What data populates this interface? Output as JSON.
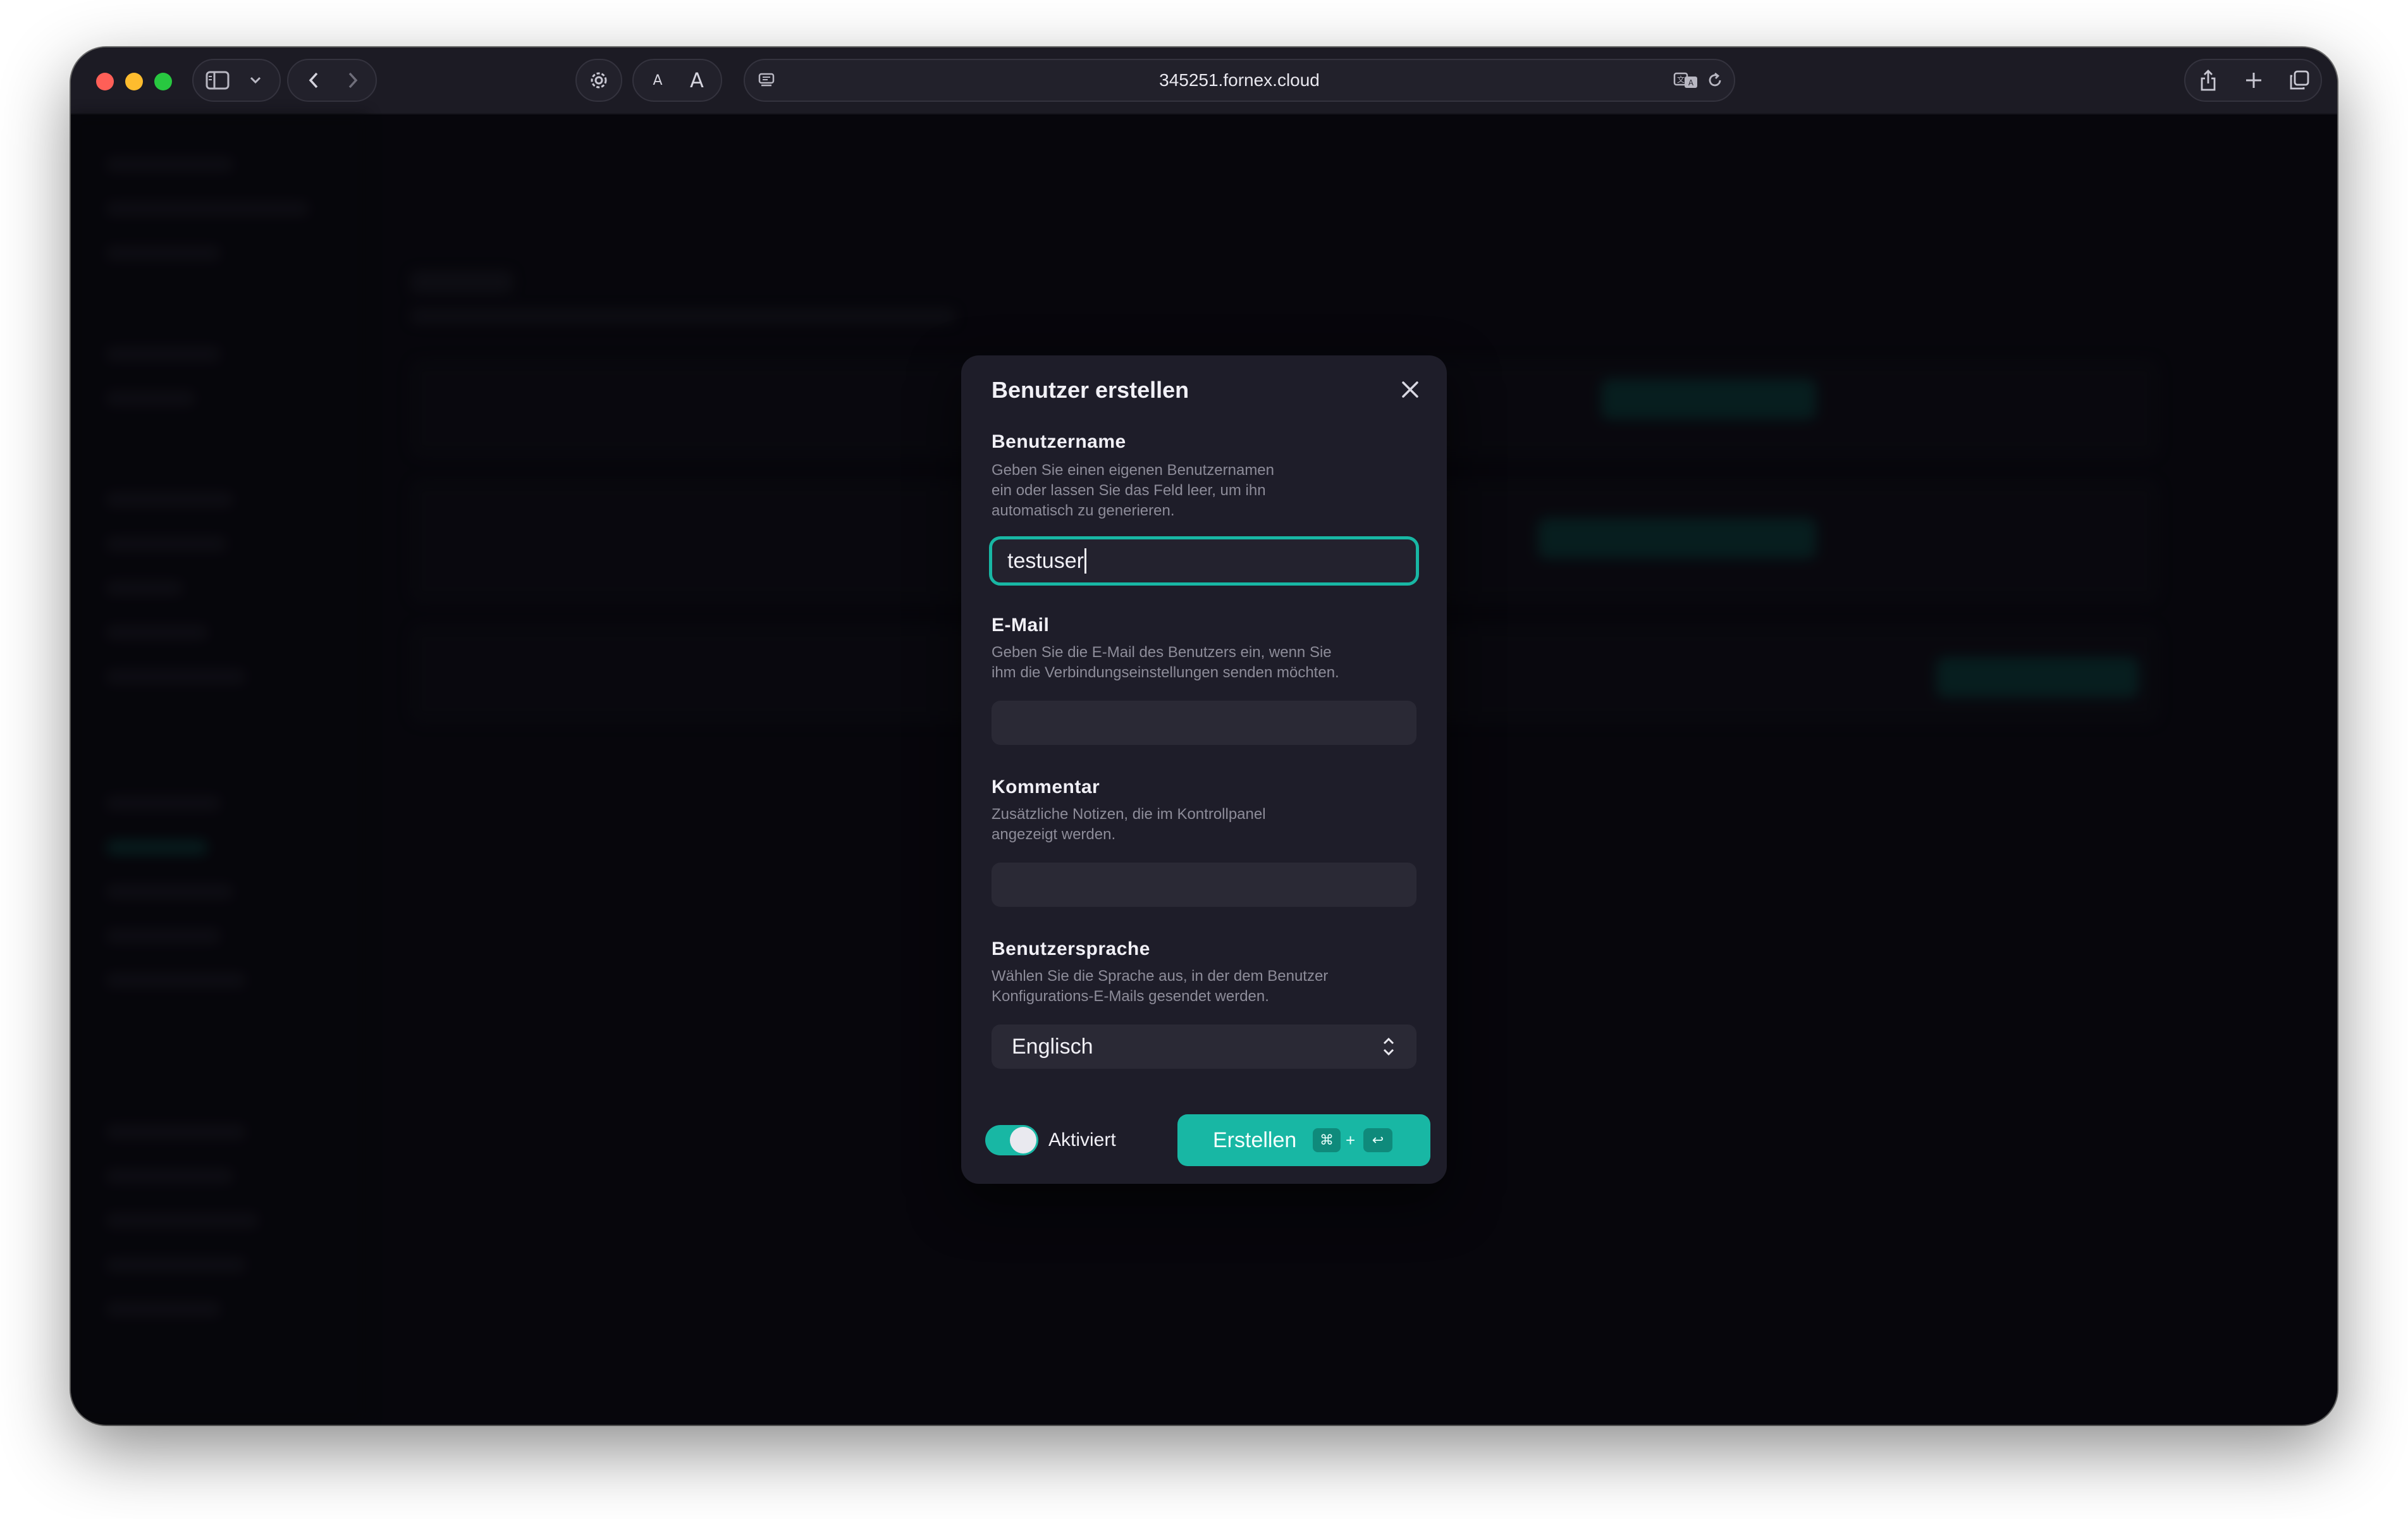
{
  "browser": {
    "url": "345251.fornex.cloud",
    "reader_small_label": "A",
    "reader_large_label": "A"
  },
  "modal": {
    "title": "Benutzer erstellen",
    "username": {
      "label": "Benutzername",
      "help_lines": [
        "Geben Sie einen eigenen Benutzernamen",
        "ein oder lassen Sie das Feld leer, um ihn",
        "automatisch zu generieren."
      ],
      "value": "testuser"
    },
    "email": {
      "label": "E-Mail",
      "help_lines": [
        "Geben Sie die E-Mail des Benutzers ein, wenn Sie",
        "ihm die Verbindungseinstellungen senden möchten."
      ],
      "value": ""
    },
    "comment": {
      "label": "Kommentar",
      "help_lines": [
        "Zusätzliche Notizen, die im Kontrollpanel",
        "angezeigt werden."
      ],
      "value": ""
    },
    "language": {
      "label": "Benutzersprache",
      "help_lines": [
        "Wählen Sie die Sprache aus, in der dem Benutzer",
        "Konfigurations-E-Mails gesendet werden."
      ],
      "selected": "Englisch"
    },
    "enabled_toggle": {
      "label": "Aktiviert",
      "on": true
    },
    "create_button": {
      "label": "Erstellen",
      "shortcut_mod": "⌘",
      "shortcut_plus": "+",
      "shortcut_key": "↩"
    }
  },
  "colors": {
    "accent": "#18b7a4",
    "modal_bg": "#1e1d29",
    "field_bg": "#2a2935"
  },
  "icons": [
    "sidebar-icon",
    "chevron-down-icon",
    "back-icon",
    "forward-icon",
    "gear-icon",
    "page-menu-icon",
    "translate-icon",
    "reload-icon",
    "share-icon",
    "plus-icon",
    "tabs-icon",
    "close-icon",
    "updown-chevron-icon"
  ]
}
